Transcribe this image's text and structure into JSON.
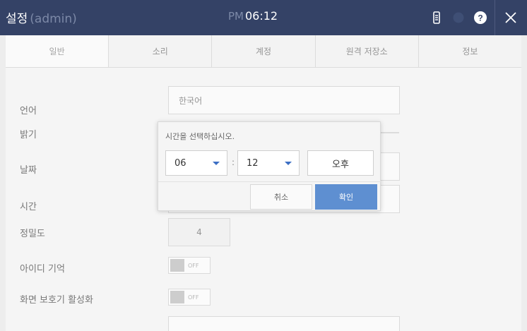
{
  "header": {
    "title": "설정",
    "subtitle": "(admin)",
    "ampm": "PM",
    "time": "06:12",
    "icons": [
      "storage-icon",
      "status-circle-icon",
      "help-icon",
      "close-icon"
    ]
  },
  "tabs": [
    {
      "label": "일반",
      "active": true
    },
    {
      "label": "소리",
      "active": false
    },
    {
      "label": "계정",
      "active": false
    },
    {
      "label": "원격 저장소",
      "active": false
    },
    {
      "label": "정보",
      "active": false
    }
  ],
  "settings": {
    "language": {
      "label": "언어",
      "value": "한국어"
    },
    "brightness": {
      "label": "밝기"
    },
    "date": {
      "label": "날짜"
    },
    "time": {
      "label": "시간"
    },
    "precision": {
      "label": "정밀도",
      "value": "4"
    },
    "remember_id": {
      "label": "아이디 기억",
      "state": "OFF"
    },
    "screensaver": {
      "label": "화면 보호기 활성화",
      "state": "OFF"
    }
  },
  "dialog": {
    "prompt": "시간을 선택하십시오.",
    "hour": "06",
    "minute": "12",
    "separator": ":",
    "ampm": "오후",
    "cancel": "취소",
    "confirm": "확인"
  },
  "colors": {
    "header_bg": "#1d2d55",
    "accent": "#5e8fd1",
    "caret": "#3c6fc4"
  }
}
